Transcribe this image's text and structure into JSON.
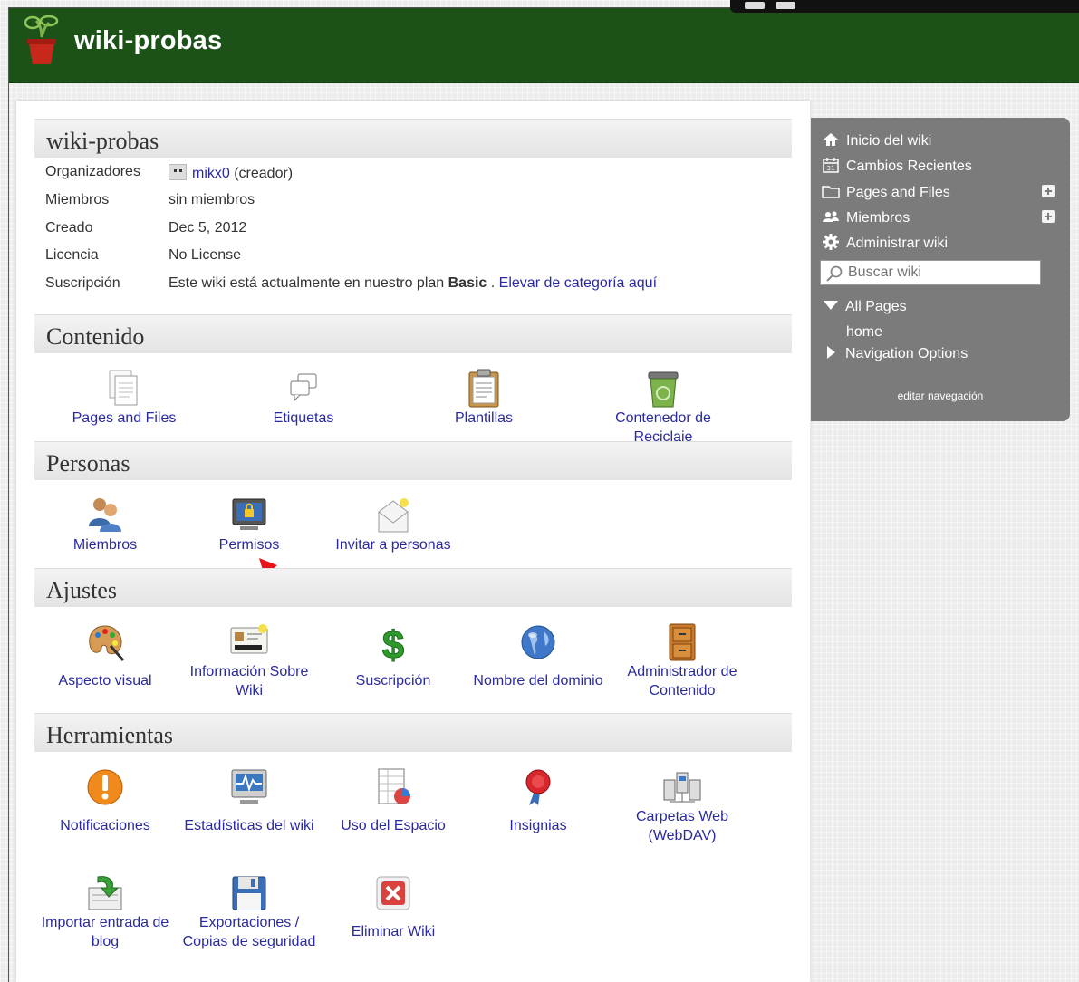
{
  "header": {
    "title": "wiki-probas"
  },
  "info": {
    "title": "wiki-probas",
    "rows": [
      {
        "label": "Organizadores",
        "value": ""
      },
      {
        "label": "Miembros",
        "value": "sin miembros"
      },
      {
        "label": "Creado",
        "value": "Dec 5, 2012"
      },
      {
        "label": "Licencia",
        "value": "No License"
      },
      {
        "label": "Suscripción",
        "value": ""
      }
    ],
    "organizer_user": "mikx0",
    "organizer_role": " (creador)",
    "subscription_prefix": "Este wiki está actualmente en nuestro plan ",
    "subscription_plan": "Basic",
    "subscription_sep": " . ",
    "subscription_link": "Elevar de categoría aquí"
  },
  "contenido": {
    "title": "Contenido",
    "items": [
      {
        "label": "Pages and Files",
        "icon": "pages-files-icon"
      },
      {
        "label": "Etiquetas",
        "icon": "tags-icon"
      },
      {
        "label": "Plantillas",
        "icon": "templates-icon"
      },
      {
        "label": "Contenedor de Reciclaje",
        "icon": "recycle-bin-icon"
      }
    ]
  },
  "personas": {
    "title": "Personas",
    "items": [
      {
        "label": "Miembros",
        "icon": "members-icon"
      },
      {
        "label": "Permisos",
        "icon": "permissions-icon"
      },
      {
        "label": "Invitar a personas",
        "icon": "invite-icon"
      }
    ]
  },
  "ajustes": {
    "title": "Ajustes",
    "items": [
      {
        "label": "Aspecto visual",
        "icon": "palette-icon"
      },
      {
        "label1": "Información Sobre",
        "label2": "Wiki",
        "icon": "id-card-icon"
      },
      {
        "label": "Suscripción",
        "icon": "dollar-icon"
      },
      {
        "label": "Nombre del dominio",
        "icon": "globe-icon"
      },
      {
        "label1": "Administrador de",
        "label2": "Contenido",
        "icon": "cabinet-icon"
      }
    ]
  },
  "herramientas": {
    "title": "Herramientas",
    "items": [
      {
        "label": "Notificaciones",
        "icon": "alert-icon"
      },
      {
        "label": "Estadísticas del wiki",
        "icon": "monitor-stats-icon"
      },
      {
        "label": "Uso del Espacio",
        "icon": "space-usage-icon"
      },
      {
        "label": "Insignias",
        "icon": "badge-icon"
      },
      {
        "label1": "Carpetas Web",
        "label2": "(WebDAV)",
        "icon": "network-folders-icon"
      },
      {
        "label1": "Importar entrada de",
        "label2": "blog",
        "icon": "import-icon"
      },
      {
        "label1": "Exportaciones /",
        "label2": "Copias de seguridad",
        "icon": "floppy-icon"
      },
      {
        "label": "Eliminar Wiki",
        "icon": "delete-icon"
      }
    ]
  },
  "nav": {
    "items": [
      {
        "label": "Inicio del wiki",
        "icon": "home-icon"
      },
      {
        "label": "Cambios Recientes",
        "icon": "calendar-icon"
      },
      {
        "label": "Pages and Files",
        "icon": "folder-icon"
      },
      {
        "label": "Miembros",
        "icon": "people-icon"
      },
      {
        "label": "Administrar wiki",
        "icon": "gear-icon"
      }
    ],
    "search_placeholder": "Buscar wiki",
    "tree": {
      "all_pages": "All Pages",
      "home": "home",
      "navigation_options": "Navigation Options"
    },
    "edit_link": "editar navegación"
  },
  "colors": {
    "header": "#1c5218",
    "link": "#2a2aa0",
    "nav_bg": "#7b7b7b",
    "annotation_arrow": "#e8141b"
  }
}
